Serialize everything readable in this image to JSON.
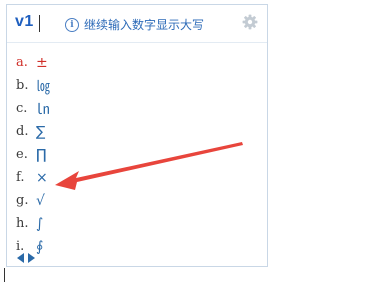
{
  "ime": {
    "input_text": "v1",
    "hint": "继续输入数字显示大写",
    "icons": {
      "info": "info-icon",
      "settings": "gear-icon",
      "prev": "triangle-left-icon",
      "next": "triangle-right-icon"
    },
    "candidates": [
      {
        "index": "a.",
        "symbol": "±",
        "selected": true
      },
      {
        "index": "b.",
        "symbol": "㏒",
        "selected": false
      },
      {
        "index": "c.",
        "symbol": "㏑",
        "selected": false
      },
      {
        "index": "d.",
        "symbol": "∑",
        "selected": false
      },
      {
        "index": "e.",
        "symbol": "∏",
        "selected": false
      },
      {
        "index": "f.",
        "symbol": "×",
        "selected": false
      },
      {
        "index": "g.",
        "symbol": "√",
        "selected": false
      },
      {
        "index": "h.",
        "symbol": "∫",
        "selected": false
      },
      {
        "index": "i.",
        "symbol": "∮",
        "selected": false
      }
    ]
  },
  "colors": {
    "selected": "#d0302a",
    "symbol": "#2b6aa8",
    "accent": "#1f5fbf",
    "annotation_arrow": "#e8453c"
  }
}
